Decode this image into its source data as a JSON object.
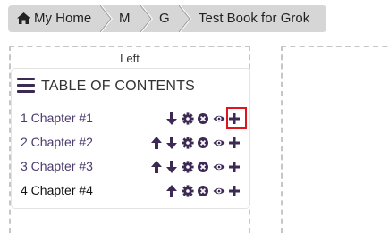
{
  "breadcrumb": {
    "items": [
      {
        "label": "My Home",
        "icon": "home-icon"
      },
      {
        "label": "M"
      },
      {
        "label": "G"
      },
      {
        "label": "Test Book for Grok"
      }
    ]
  },
  "layout": {
    "left_column_title": "Left"
  },
  "toc": {
    "title": "TABLE OF CONTENTS",
    "chapters": [
      {
        "label": "1 Chapter #1",
        "actions": [
          "move-down-icon",
          "settings-icon",
          "remove-icon",
          "view-icon",
          "add-icon"
        ],
        "highlighted_action": "add-icon"
      },
      {
        "label": "2 Chapter #2",
        "actions": [
          "move-up-icon",
          "move-down-icon",
          "settings-icon",
          "remove-icon",
          "view-icon",
          "add-icon"
        ]
      },
      {
        "label": "3 Chapter #3",
        "actions": [
          "move-up-icon",
          "move-down-icon",
          "settings-icon",
          "remove-icon",
          "view-icon",
          "add-icon"
        ]
      },
      {
        "label": "4 Chapter #4",
        "actions": [
          "move-up-icon",
          "settings-icon",
          "remove-icon",
          "view-icon",
          "add-icon"
        ],
        "current": true
      }
    ]
  },
  "colors": {
    "accent": "#3c2a55",
    "chapter_link": "#4a3a6e",
    "highlight": "#e0141c",
    "breadcrumb_bg": "#d6d6d6"
  }
}
